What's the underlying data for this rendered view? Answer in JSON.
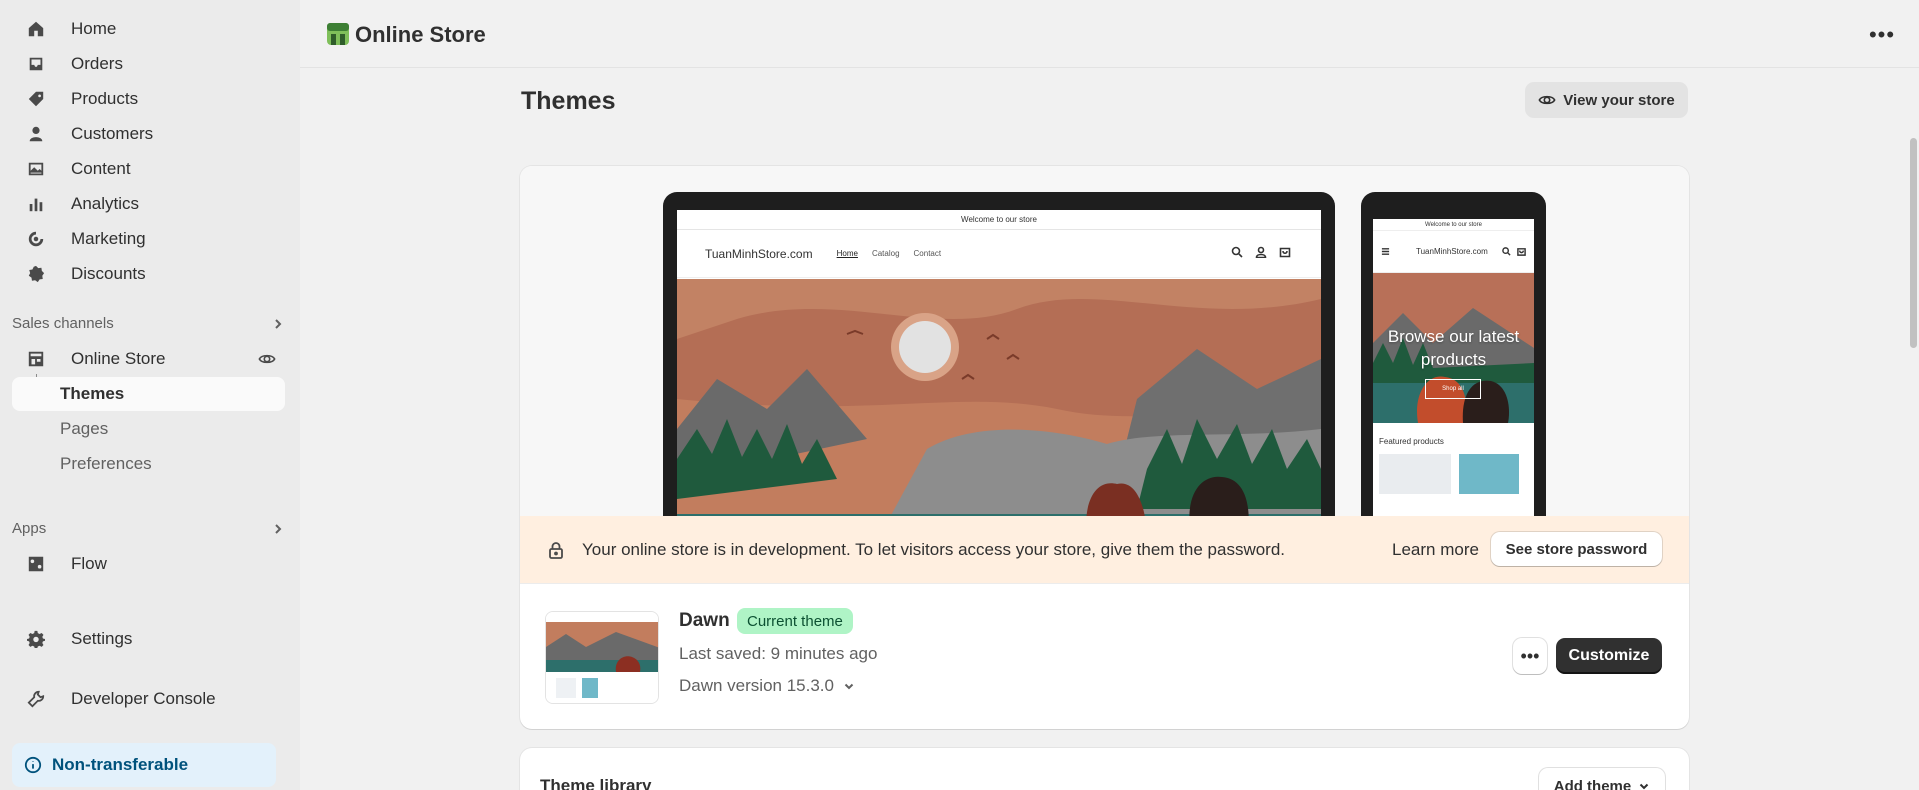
{
  "sidebar": {
    "items": [
      {
        "label": "Home",
        "icon": "home-icon"
      },
      {
        "label": "Orders",
        "icon": "inbox-icon"
      },
      {
        "label": "Products",
        "icon": "tag-icon"
      },
      {
        "label": "Customers",
        "icon": "person-icon"
      },
      {
        "label": "Content",
        "icon": "image-icon"
      },
      {
        "label": "Analytics",
        "icon": "bar-chart-icon"
      },
      {
        "label": "Marketing",
        "icon": "target-icon"
      },
      {
        "label": "Discounts",
        "icon": "discount-icon"
      }
    ],
    "sales_channels": {
      "heading": "Sales channels",
      "online_store": "Online Store",
      "sub": [
        "Themes",
        "Pages",
        "Preferences"
      ]
    },
    "apps": {
      "heading": "Apps",
      "flow": "Flow"
    },
    "settings": "Settings",
    "developer_console": "Developer Console",
    "non_transferable": "Non-transferable"
  },
  "topbar": {
    "title": "Online Store",
    "more": "•••"
  },
  "main": {
    "page_title": "Themes",
    "view_store": "View your store"
  },
  "preview": {
    "desktop": {
      "announcement": "Welcome to our store",
      "logo": "TuanMinhStore.com",
      "nav": [
        "Home",
        "Catalog",
        "Contact"
      ]
    },
    "mobile": {
      "announcement": "Welcome to our store",
      "logo": "TuanMinhStore.com",
      "hero_text": "Browse our latest products",
      "shop_all": "Shop all",
      "featured": "Featured products"
    }
  },
  "banner": {
    "message": "Your online store is in development. To let visitors access your store, give them the password.",
    "learn_more": "Learn more",
    "see_password": "See store password"
  },
  "theme": {
    "name": "Dawn",
    "badge": "Current theme",
    "last_saved": "Last saved: 9 minutes ago",
    "version": "Dawn version 15.3.0",
    "more": "•••",
    "customize": "Customize"
  },
  "library": {
    "title": "Theme library",
    "add_theme": "Add theme"
  },
  "colors": {
    "accent_dark": "#303030",
    "badge_bg": "#aff4c6",
    "banner_bg": "#ffefe0",
    "info_bg": "#e3f1fb"
  }
}
